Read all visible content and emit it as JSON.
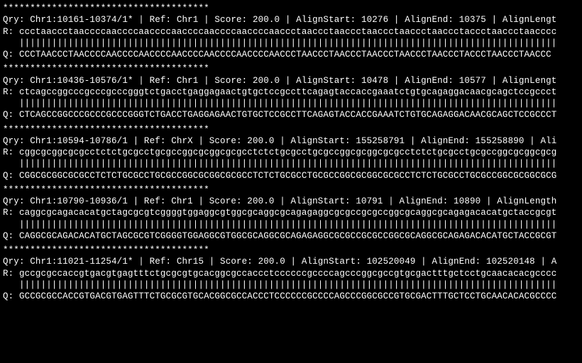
{
  "separator": "**************************************",
  "records": [
    {
      "header": "Qry: Chr1:10161-10374/1* | Ref: Chr1 | Score: 200.0 | AlignStart: 10276 | AlignEnd: 10375 | AlignLengt",
      "ref": "R: ccctaaccctaaccccaaccccaaccccaaccccaaccccaaccccaaccctaaccctaaccctaaccctaaccctaaccctaccctaaccctaacccc",
      "match": "   |||||||||||||||||||||||||||||||||||||||||||||||||||||||||||||||||||||||||||||||||||||||||||||||||||",
      "qry": "Q: CCCTAACCCTAACCCCAACCCCAACCCCAACCCCAACCCCAACCCCAACCCTAACCCTAACCCTAACCCTAACCCTAACCCTACCCTAACCCTAACCC"
    },
    {
      "header": "Qry: Chr1:10436-10576/1* | Ref: Chr1 | Score: 200.0 | AlignStart: 10478 | AlignEnd: 10577 | AlignLengt",
      "ref": "R: ctcagccggcccgcccgcccgggtctgacctgaggagaactgtgctccgccttcagagtaccaccgaaatctgtgcagaggacaacgcagctccgccct",
      "match": "   |||||||||||||||||||||||||||||||||||||||||||||||||||||||||||||||||||||||||||||||||||||||||||||||||||",
      "qry": "Q: CTCAGCCGGCCCGCCCGCCCGGGTCTGACCTGAGGAGAACTGTGCTCCGCCTTCAGAGTACCACCGAAATCTGTGCAGAGGACAACGCAGCTCCGCCCT"
    },
    {
      "header": "Qry: Chr1:10594-10786/1 | Ref: ChrX | Score: 200.0 | AlignStart: 155258791 | AlignEnd: 155258890 | Ali",
      "ref": "R: cggcgcggcgcgcctctctgcgcctgcgccggcgcggcgcgcctctctgcgcctgcgccggcgcggcgcgcctctctgcgcctgcgccggcgcggcgcg",
      "match": "   |||||||||||||||||||||||||||||||||||||||||||||||||||||||||||||||||||||||||||||||||||||||||||||||||||",
      "qry": "Q: CGGCGCGGCGCGCCTCTCTGCGCCTGCGCCGGCGCGGCGCGCCTCTCTGCGCCTGCGCCGGCGCGGCGCGCCTCTCTGCGCCTGCGCCGGCGCGGCGCG"
    },
    {
      "header": "Qry: Chr1:10790-10936/1 | Ref: Chr1 | Score: 200.0 | AlignStart: 10791 | AlignEnd: 10890 | AlignLength",
      "ref": "R: caggcgcagacacatgctagcgcgtcggggtggaggcgtggcgcaggcgcagagaggcgcgccgcgccggcgcaggcgcagagacacatgctaccgcgt",
      "match": "   |||||||||||||||||||||||||||||||||||||||||||||||||||||||||||||||||||||||||||||||||||||||||||||||||||",
      "qry": "Q: CAGGCGCAGACACATGCTAGCGCGTCGGGGTGGAGGCGTGGCGCAGGCGCAGAGAGGCGCGCCGCGCCGGCGCAGGCGCAGAGACACATGCTACCGCGT"
    },
    {
      "header": "Qry: Chr1:11021-11254/1* | Ref: Chr15 | Score: 200.0 | AlignStart: 102520049 | AlignEnd: 102520148 | A",
      "ref": "R: gccgcgccaccgtgacgtgagtttctgcgcgtgcacggcgccaccctccccccgccccagcccggcgccgtgcgactttgctcctgcaacacacgcccc",
      "match": "   |||||||||||||||||||||||||||||||||||||||||||||||||||||||||||||||||||||||||||||||||||||||||||||||||||",
      "qry": "Q: GCCGCGCCACCGTGACGTGAGTTTCTGCGCGTGCACGGCGCCACCCTCCCCCCGCCCCAGCCCGGCGCCGTGCGACTTTGCTCCTGCAACACACGCCCC"
    }
  ]
}
